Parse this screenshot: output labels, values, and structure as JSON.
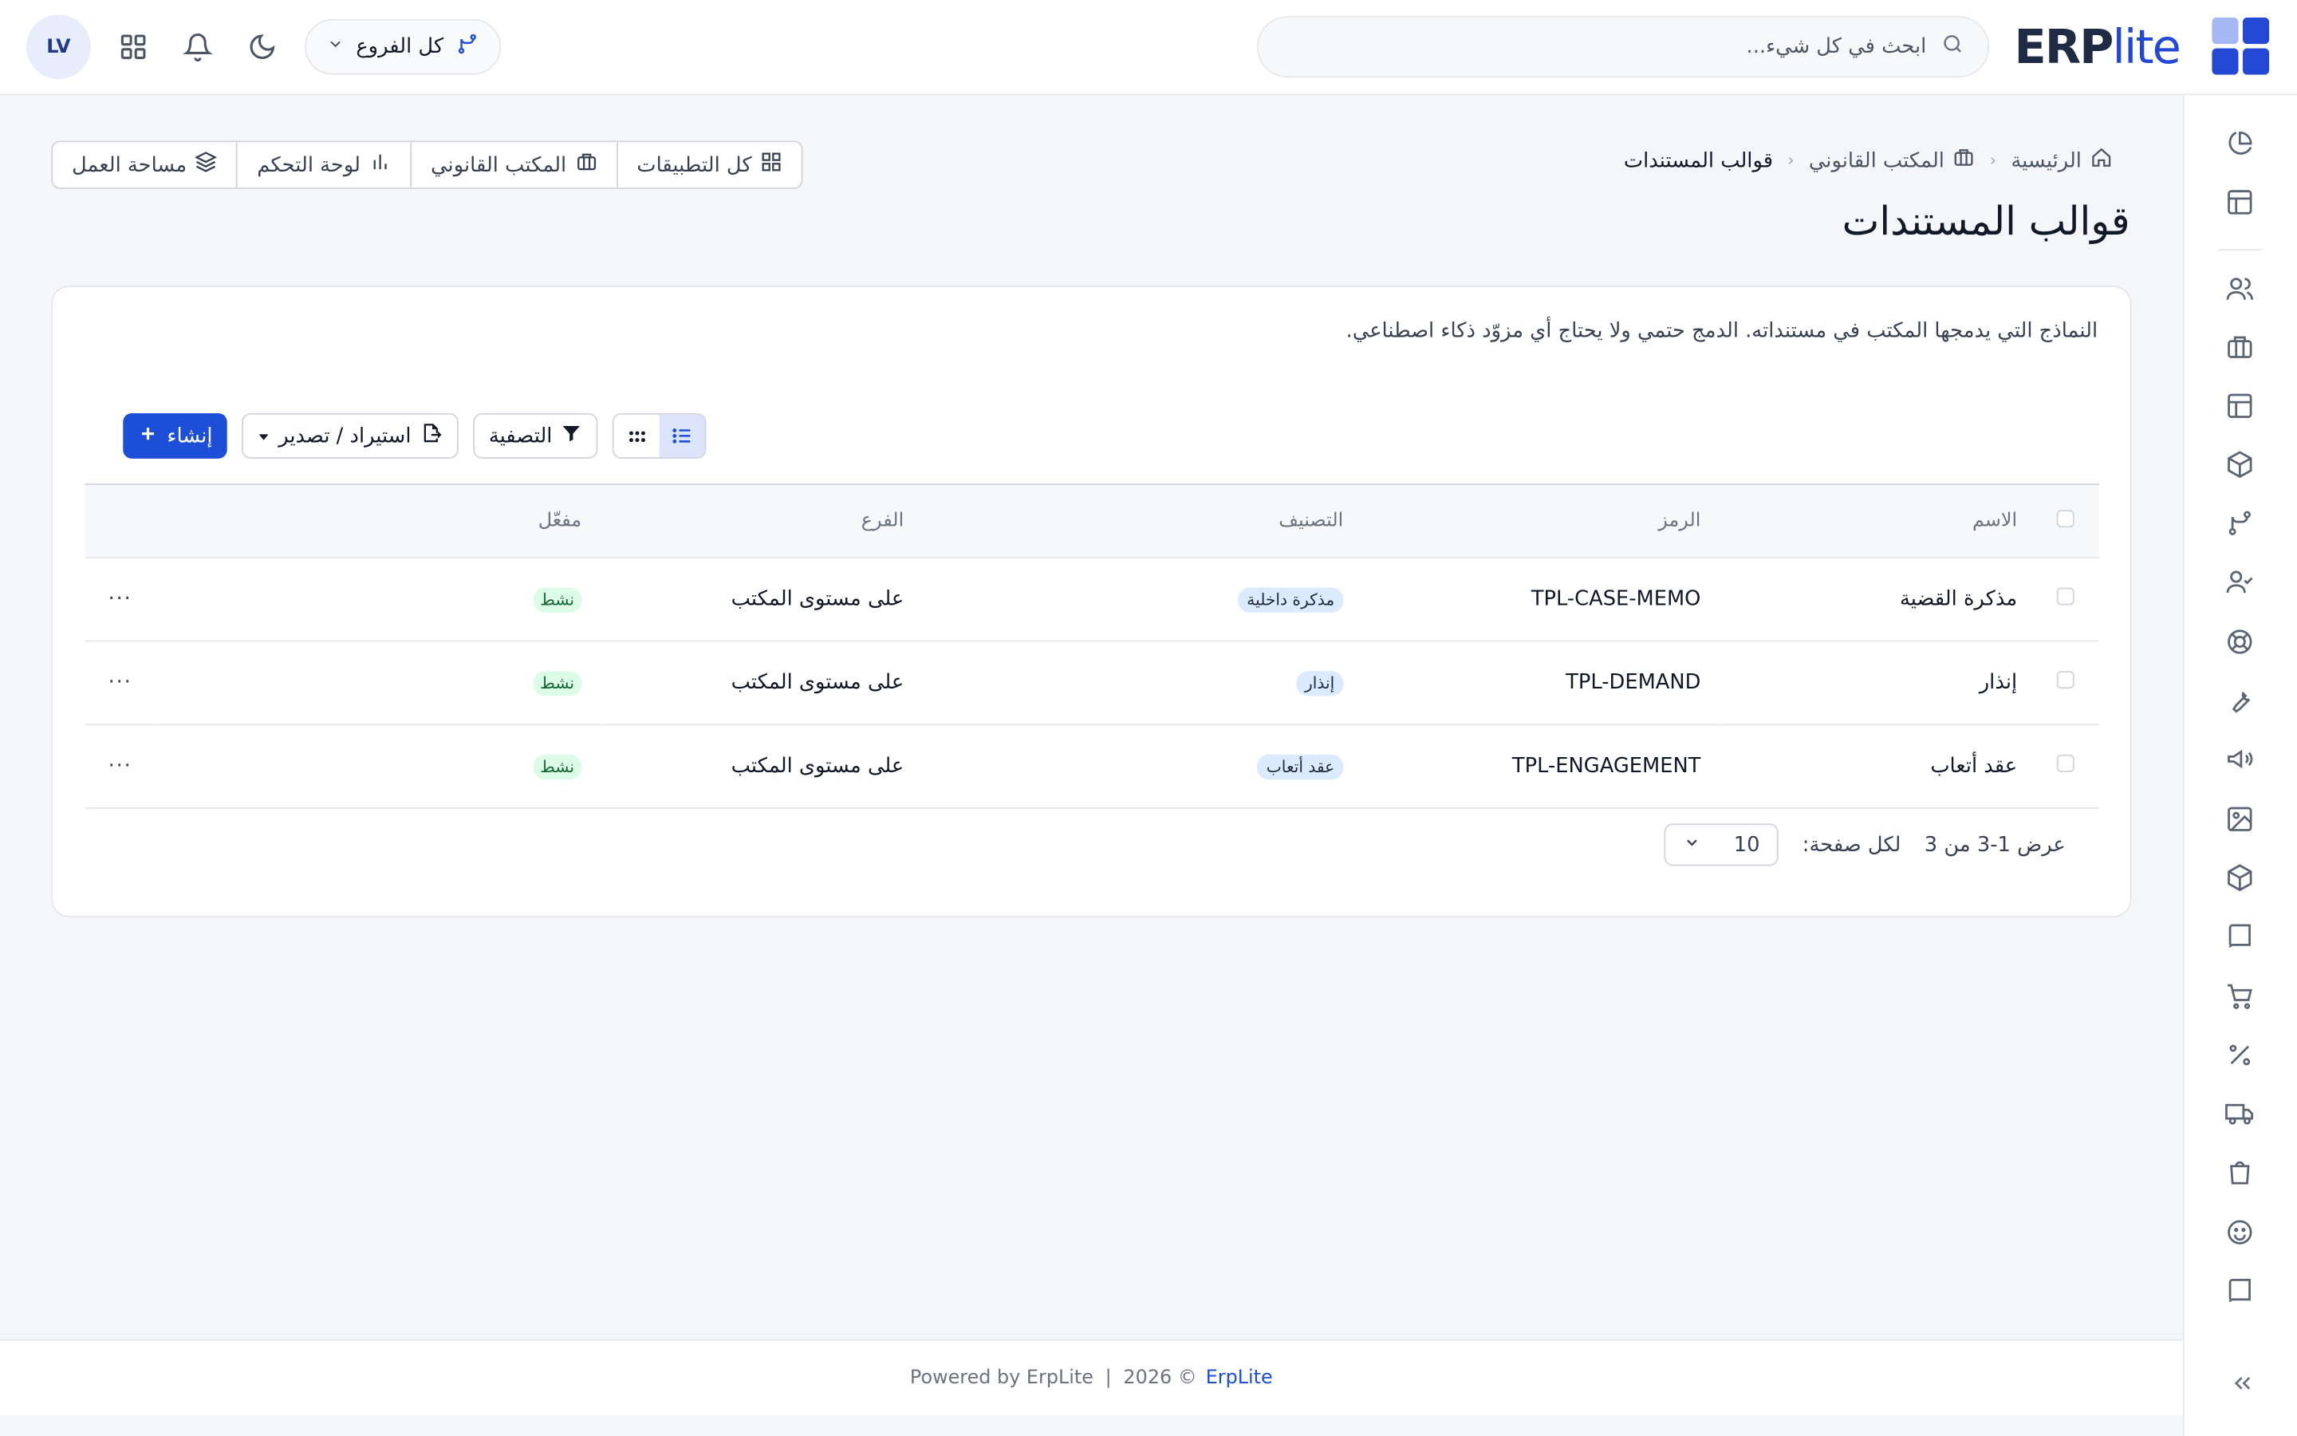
{
  "app": {
    "logo_text": "ERP",
    "logo_text_accent": "lite"
  },
  "header": {
    "search_placeholder": "ابحث في كل شيء...",
    "branch_label": "كل الفروع",
    "avatar_initials": "LV"
  },
  "breadcrumb": [
    {
      "label": "الرئيسية",
      "icon": "home-icon"
    },
    {
      "label": "المكتب القانوني",
      "icon": "briefcase-icon"
    },
    {
      "label": "قوالب المستندات"
    }
  ],
  "page_title": "قوالب المستندات",
  "apps_bar": {
    "all_apps": "كل التطبيقات",
    "legal_office": "المكتب القانوني",
    "dashboard": "لوحة التحكم",
    "workspace": "مساحة العمل"
  },
  "description": "النماذج التي يدمجها المكتب في مستنداته. الدمج حتمي ولا يحتاج أي مزوّد ذكاء اصطناعي.",
  "toolbar": {
    "create": "إنشاء",
    "import_export": "استيراد / تصدير",
    "filter": "التصفية"
  },
  "table": {
    "columns": {
      "name": "الاسم",
      "code": "الرمز",
      "category": "التصنيف",
      "branch": "الفرع",
      "enabled": "مفعّل"
    },
    "rows": [
      {
        "name": "مذكرة القضية",
        "code": "TPL-CASE-MEMO",
        "category": "مذكرة داخلية",
        "branch": "على مستوى المكتب",
        "status": "نشط",
        "actions": "···"
      },
      {
        "name": "إنذار",
        "code": "TPL-DEMAND",
        "category": "إنذار",
        "branch": "على مستوى المكتب",
        "status": "نشط",
        "actions": "···"
      },
      {
        "name": "عقد أتعاب",
        "code": "TPL-ENGAGEMENT",
        "category": "عقد أتعاب",
        "branch": "على مستوى المكتب",
        "status": "نشط",
        "actions": "···"
      }
    ]
  },
  "pagination": {
    "showing": "عرض 1-3 من 3",
    "per_page_label": "لكل صفحة:",
    "per_page_value": "10"
  },
  "footer": {
    "powered": "Powered by ErpLite",
    "separator": "|",
    "year": "2026 ©",
    "brand": "ErpLite"
  },
  "colors": {
    "accent": "#1d4ed8",
    "logo_dark": "#2348d6",
    "logo_light": "#a5b8f5",
    "status_green_bg": "#dcfce7",
    "tag_blue_bg": "#dbeafe"
  }
}
